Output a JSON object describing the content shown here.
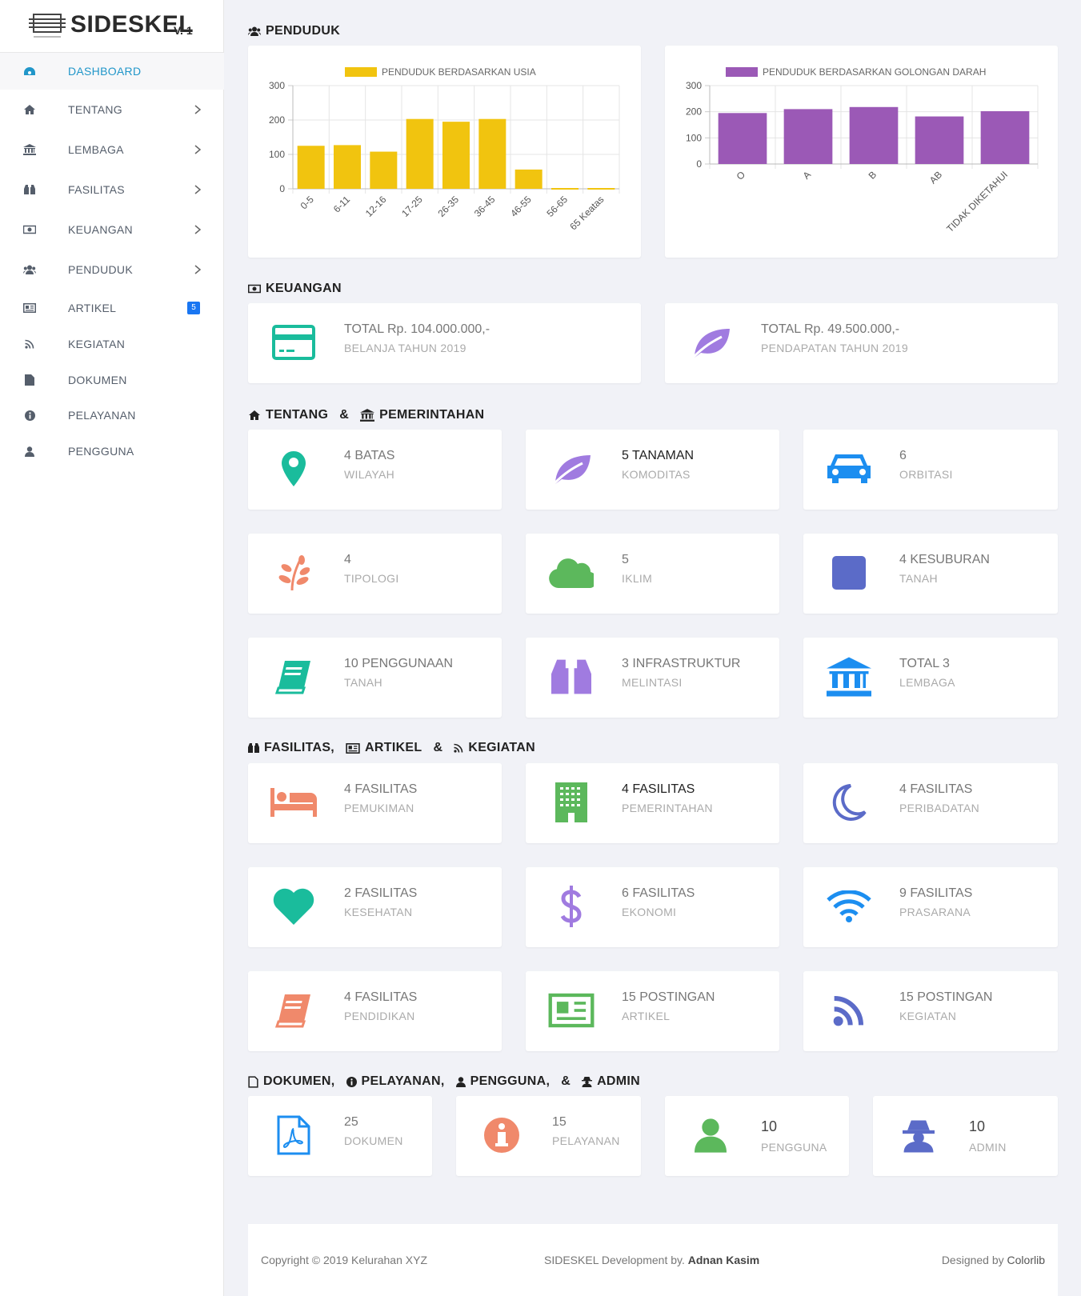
{
  "brand": {
    "name": "SIDESKEL",
    "version": "V. 1"
  },
  "sidebar": {
    "items": [
      {
        "label": "DASHBOARD",
        "icon": "dashboard-icon"
      },
      {
        "label": "TENTANG",
        "icon": "home-icon"
      },
      {
        "label": "LEMBAGA",
        "icon": "institution-icon"
      },
      {
        "label": "FASILITAS",
        "icon": "binoculars-icon"
      },
      {
        "label": "KEUANGAN",
        "icon": "money-icon"
      },
      {
        "label": "PENDUDUK",
        "icon": "users-icon"
      },
      {
        "label": "ARTIKEL",
        "icon": "newspaper-icon",
        "badge": "5"
      },
      {
        "label": "KEGIATAN",
        "icon": "rss-icon"
      },
      {
        "label": "DOKUMEN",
        "icon": "file-icon"
      },
      {
        "label": "PELAYANAN",
        "icon": "info-icon"
      },
      {
        "label": "PENGGUNA",
        "icon": "user-icon"
      }
    ]
  },
  "sections": {
    "penduduk": "PENDUDUK",
    "keuangan": "KEUANGAN",
    "tentang": "TENTANG",
    "amp1": "&",
    "pemerintahan": "PEMERINTAHAN",
    "fasilitas": "FASILITAS,",
    "artikel": "ARTIKEL",
    "amp2": "&",
    "kegiatan": "KEGIATAN",
    "dokumen": "DOKUMEN,",
    "pelayanan": "PELAYANAN,",
    "pengguna": "PENGGUNA,",
    "amp3": "&",
    "admin": "ADMIN"
  },
  "chart_data": [
    {
      "type": "bar",
      "title": "PENDUDUK BERDASARKAN USIA",
      "categories": [
        "0-5",
        "6-11",
        "12-16",
        "17-25",
        "26-35",
        "36-45",
        "46-55",
        "56-65",
        "65 Keatas"
      ],
      "values": [
        125,
        127,
        108,
        203,
        195,
        203,
        56,
        0,
        0
      ],
      "yticks": [
        0,
        100,
        200,
        300
      ],
      "ylim": [
        0,
        300
      ],
      "color": "#f1c40f",
      "legend": "top"
    },
    {
      "type": "bar",
      "title": "PENDUDUK BERDASARKAN GOLONGAN DARAH",
      "categories": [
        "O",
        "A",
        "B",
        "AB",
        "TIDAK DIKETAHUI"
      ],
      "values": [
        195,
        210,
        218,
        182,
        202
      ],
      "yticks": [
        0,
        100,
        200,
        300
      ],
      "ylim": [
        0,
        300
      ],
      "color": "#9b59b6",
      "legend": "top"
    }
  ],
  "keuangan": [
    {
      "value": "TOTAL Rp. 104.000.000,-",
      "label": "BELANJA TAHUN 2019",
      "icon": "credit-card-icon",
      "color": "#1abc9c"
    },
    {
      "value": "TOTAL Rp. 49.500.000,-",
      "label": "PENDAPATAN TAHUN 2019",
      "icon": "leaf-icon",
      "color": "#a07be0"
    }
  ],
  "tentang": [
    {
      "value": "4 BATAS",
      "label": "WILAYAH",
      "icon": "map-marker-icon",
      "color": "#1abc9c"
    },
    {
      "value": "5 TANAMAN",
      "label": "KOMODITAS",
      "icon": "leaf-icon",
      "color": "#a07be0"
    },
    {
      "value": "6",
      "label": "ORBITASI",
      "icon": "car-icon",
      "color": "#1c8ef0"
    },
    {
      "value": "4",
      "label": "TIPOLOGI",
      "icon": "plant-icon",
      "color": "#f0896b"
    },
    {
      "value": "5",
      "label": "IKLIM",
      "icon": "cloud-icon",
      "color": "#5cb85c"
    },
    {
      "value": "4 KESUBURAN",
      "label": "TANAH",
      "icon": "square-icon",
      "color": "#5b6bc8"
    },
    {
      "value": "10 PENGGUNAAN",
      "label": "TANAH",
      "icon": "book-icon",
      "color": "#1abc9c"
    },
    {
      "value": "3 INFRASTRUKTUR",
      "label": "MELINTASI",
      "icon": "binoculars-icon",
      "color": "#a07be0"
    },
    {
      "value": "TOTAL 3",
      "label": "LEMBAGA",
      "icon": "institution-icon",
      "color": "#1c8ef0"
    }
  ],
  "fasilitas": [
    {
      "value": "4 FASILITAS",
      "label": "PEMUKIMAN",
      "icon": "bed-icon",
      "color": "#f0896b"
    },
    {
      "value": "4 FASILITAS",
      "label": "PEMERINTAHAN",
      "icon": "building-icon",
      "color": "#5cb85c"
    },
    {
      "value": "4 FASILITAS",
      "label": "PERIBADATAN",
      "icon": "moon-icon",
      "color": "#5b6bc8"
    },
    {
      "value": "2 FASILITAS",
      "label": "KESEHATAN",
      "icon": "heart-icon",
      "color": "#1abc9c"
    },
    {
      "value": "6 FASILITAS",
      "label": "EKONOMI",
      "icon": "dollar-icon",
      "color": "#a07be0"
    },
    {
      "value": "9 FASILITAS",
      "label": "PRASARANA",
      "icon": "wifi-icon",
      "color": "#1c8ef0"
    },
    {
      "value": "4 FASILITAS",
      "label": "PENDIDIKAN",
      "icon": "book-icon",
      "color": "#f0896b"
    },
    {
      "value": "15 POSTINGAN",
      "label": "ARTIKEL",
      "icon": "newspaper-icon",
      "color": "#5cb85c"
    },
    {
      "value": "15 POSTINGAN",
      "label": "KEGIATAN",
      "icon": "rss-icon",
      "color": "#5b6bc8"
    }
  ],
  "dokumen": [
    {
      "value": "25",
      "label": "DOKUMEN",
      "icon": "pdf-file-icon",
      "color": "#1c8ef0"
    },
    {
      "value": "15",
      "label": "PELAYANAN",
      "icon": "info-circle-icon",
      "color": "#f0896b"
    },
    {
      "value": "10",
      "label": "PENGGUNA",
      "icon": "user-icon",
      "color": "#5cb85c"
    },
    {
      "value": "10",
      "label": "ADMIN",
      "icon": "user-secret-icon",
      "color": "#5b6bc8"
    }
  ],
  "footer": {
    "copyright": "Copyright © 2019 Kelurahan XYZ",
    "dev_prefix": "SIDESKEL Development by.",
    "dev_name": "Adnan Kasim",
    "designed_prefix": "Designed by",
    "designed_name": "Colorlib"
  }
}
